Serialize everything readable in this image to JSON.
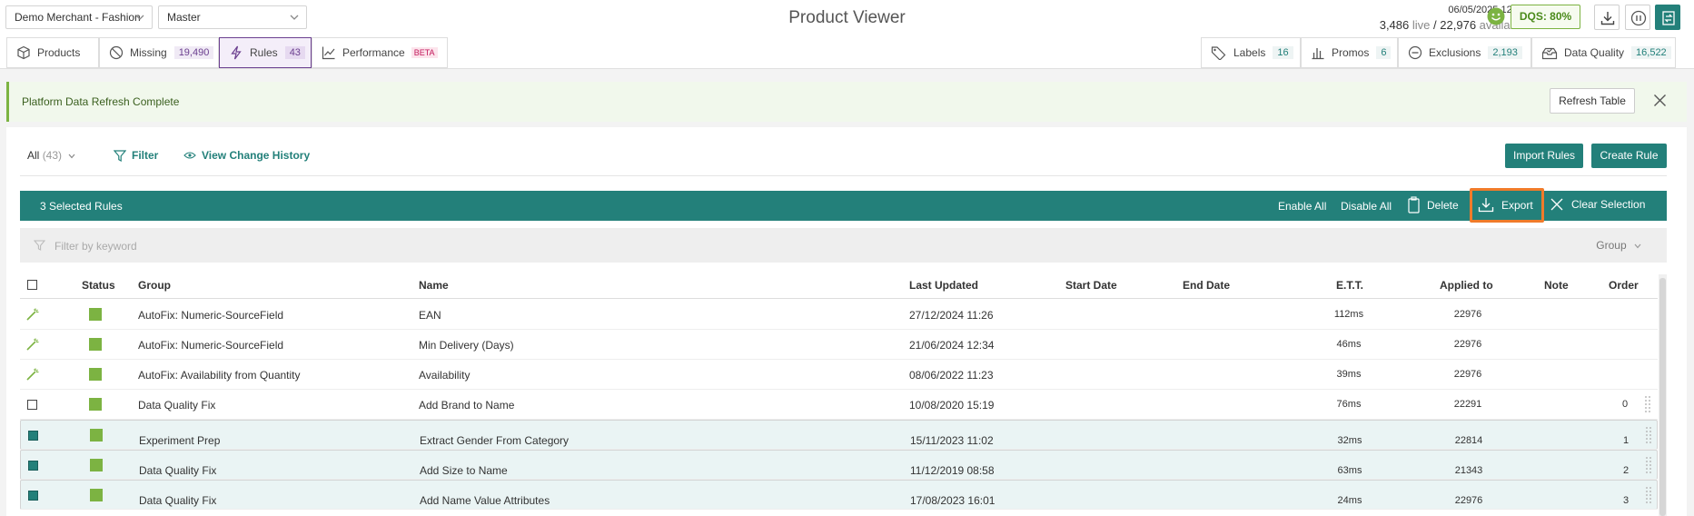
{
  "header": {
    "merchant": "Demo Merchant - Fashion",
    "branch": "Master",
    "title": "Product Viewer",
    "datetime": "06/05/2025 12:01",
    "live_count": "3,486",
    "live_label": "live",
    "separator": "/",
    "available_count": "22,976",
    "available_label": "available",
    "dqs": "DQS: 80%"
  },
  "tabs_left": [
    {
      "label": "Products",
      "count": "",
      "icon": "box-icon"
    },
    {
      "label": "Missing",
      "count": "19,490",
      "icon": "ban-icon"
    },
    {
      "label": "Rules",
      "count": "43",
      "icon": "lightning-icon",
      "active": true
    },
    {
      "label": "Performance",
      "badge": "BETA",
      "icon": "chart-line-icon"
    }
  ],
  "tabs_right": [
    {
      "label": "Labels",
      "count": "16",
      "icon": "tag-icon"
    },
    {
      "label": "Promos",
      "count": "6",
      "icon": "bar-chart-icon"
    },
    {
      "label": "Exclusions",
      "count": "2,193",
      "icon": "minus-circle-icon"
    },
    {
      "label": "Data Quality",
      "count": "16,522",
      "icon": "inbox-check-icon"
    }
  ],
  "notice": {
    "text": "Platform Data Refresh Complete",
    "refresh_label": "Refresh Table"
  },
  "toolbar": {
    "all_label": "All",
    "all_count": "(43)",
    "filter_label": "Filter",
    "history_label": "View Change History",
    "import_label": "Import Rules",
    "create_label": "Create Rule"
  },
  "selection": {
    "count_label": "3 Selected Rules",
    "enable_all": "Enable All",
    "disable_all": "Disable All",
    "delete": "Delete",
    "export": "Export",
    "clear": "Clear Selection"
  },
  "filter": {
    "placeholder": "Filter by keyword",
    "group_label": "Group"
  },
  "table": {
    "columns": [
      "Status",
      "Group",
      "Name",
      "Last Updated",
      "Start Date",
      "End Date",
      "E.T.T.",
      "Applied to",
      "Note",
      "Order"
    ],
    "rows": [
      {
        "type": "autofix",
        "group": "AutoFix: Numeric-SourceField",
        "name": "EAN",
        "updated": "27/12/2024 11:26",
        "ett": "112ms",
        "applied": "22976",
        "order": ""
      },
      {
        "type": "autofix",
        "group": "AutoFix: Numeric-SourceField",
        "name": "Min Delivery (Days)",
        "updated": "21/06/2024 12:34",
        "ett": "46ms",
        "applied": "22976",
        "order": ""
      },
      {
        "type": "autofix",
        "group": "AutoFix: Availability from Quantity",
        "name": "Availability",
        "updated": "08/06/2022 11:23",
        "ett": "39ms",
        "applied": "22976",
        "order": ""
      },
      {
        "type": "unchecked",
        "group": "Data Quality Fix",
        "name": "Add Brand to Name",
        "updated": "10/08/2020 15:19",
        "ett": "76ms",
        "applied": "22291",
        "order": "0"
      },
      {
        "type": "checked",
        "group": "Experiment Prep",
        "name": "Extract Gender From Category",
        "updated": "15/11/2023 11:02",
        "ett": "32ms",
        "applied": "22814",
        "order": "1"
      },
      {
        "type": "checked",
        "group": "Data Quality Fix",
        "name": "Add Size to Name",
        "updated": "11/12/2019 08:58",
        "ett": "63ms",
        "applied": "21343",
        "order": "2"
      },
      {
        "type": "checked",
        "group": "Data Quality Fix",
        "name": "Add Name Value Attributes",
        "updated": "17/08/2023 16:01",
        "ett": "24ms",
        "applied": "22976",
        "order": "3"
      }
    ]
  },
  "colors": {
    "teal": "#23807a",
    "status_green": "#7cb342",
    "rules_purple": "#6b3f8f",
    "export_highlight": "#f07b2a"
  }
}
